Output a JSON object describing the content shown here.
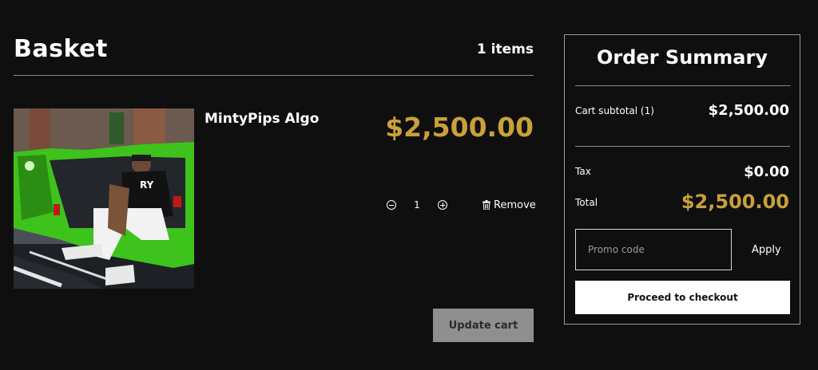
{
  "basket": {
    "title": "Basket",
    "item_count": "1 items"
  },
  "item": {
    "name": "MintyPips Algo",
    "price": "$2,500.00",
    "quantity": "1",
    "remove_label": "Remove"
  },
  "actions": {
    "update_cart": "Update cart"
  },
  "summary": {
    "title": "Order Summary",
    "subtotal_label": "Cart subtotal (1)",
    "subtotal_value": "$2,500.00",
    "tax_label": "Tax",
    "tax_value": "$0.00",
    "total_label": "Total",
    "total_value": "$2,500.00",
    "promo_placeholder": "Promo code",
    "apply_label": "Apply",
    "checkout_label": "Proceed to checkout"
  },
  "colors": {
    "accent": "#c9a13a",
    "background": "#0f0f10",
    "update_button": "#8f8f8f"
  },
  "icons": {
    "qty_decrease": "minus-circle-icon",
    "qty_increase": "plus-circle-icon",
    "remove": "trash-icon"
  }
}
